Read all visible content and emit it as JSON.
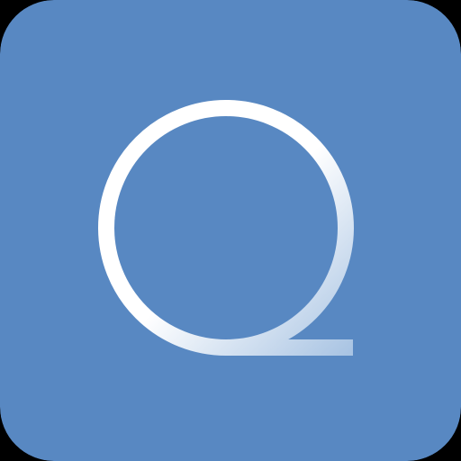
{
  "app_icon": {
    "icon_name": "q-loop-logo-icon",
    "colors": {
      "background": "#5888c2",
      "stroke_start": "#ffffff",
      "stroke_end": "#a9c4e3",
      "outer_frame": "#000000"
    }
  }
}
